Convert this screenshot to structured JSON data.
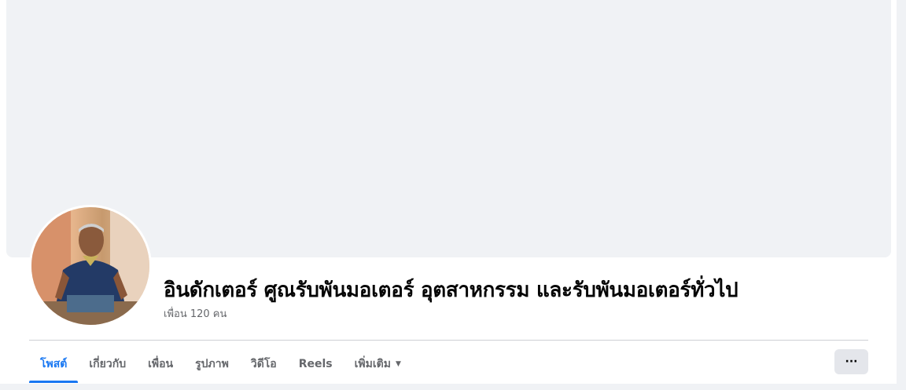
{
  "cover": {
    "color": "#f0f2f5"
  },
  "profile": {
    "name": "อินดักเตอร์ ศูณรับพันมอเตอร์ อุตสาหกรรม และรับพันมอเตอร์ทั่วไป",
    "friends": "เพื่อน 120 คน"
  },
  "tabs": [
    {
      "label": "โพสต์",
      "active": true
    },
    {
      "label": "เกี่ยวกับ",
      "active": false
    },
    {
      "label": "เพื่อน",
      "active": false
    },
    {
      "label": "รูปภาพ",
      "active": false
    },
    {
      "label": "วิดีโอ",
      "active": false
    },
    {
      "label": "Reels",
      "active": false
    },
    {
      "label": "เพิ่มเติม",
      "active": false,
      "icon": "caret-down-icon"
    }
  ],
  "more_button": {
    "label": "···",
    "icon": "more-horizontal-icon"
  },
  "colors": {
    "accent": "#1877f2",
    "secondary_text": "#65676b",
    "button_bg": "#e4e6eb"
  }
}
